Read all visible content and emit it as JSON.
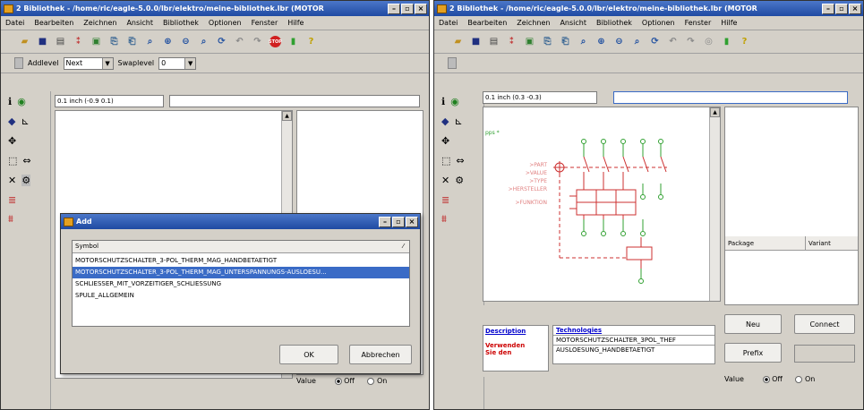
{
  "left_window": {
    "title": "2 Bibliothek - /home/ric/eagle-5.0.0/lbr/elektro/meine-bibliothek.lbr (MOTOR",
    "menu": [
      "Datei",
      "Bearbeiten",
      "Zeichnen",
      "Ansicht",
      "Bibliothek",
      "Optionen",
      "Fenster",
      "Hilfe"
    ],
    "addlevel_label": "Addlevel",
    "addlevel_value": "Next",
    "swaplevel_label": "Swaplevel",
    "swaplevel_value": "0",
    "coords": "0.1 inch (-0.9 0.1)",
    "value_label": "Value",
    "off_label": "Off",
    "on_label": "On"
  },
  "right_window": {
    "title": "2 Bibliothek - /home/ric/eagle-5.0.0/lbr/elektro/meine-bibliothek.lbr (MOTOR",
    "menu": [
      "Datei",
      "Bearbeiten",
      "Zeichnen",
      "Ansicht",
      "Bibliothek",
      "Optionen",
      "Fenster",
      "Hilfe"
    ],
    "coords": "0.1 inch (0.3 -0.3)",
    "schematic_labels": [
      ">PART",
      ">VALUE",
      ">TYPE",
      ">HERSTELLER",
      ">FUNKTION"
    ],
    "package_header": "Package",
    "variant_header": "Variant",
    "description_link": "Description",
    "technologies_link": "Technologies",
    "tech_values": [
      "MOTORSCHUTZSCHALTER_3POL_THEF",
      "AUSLOESUNG_HANDBETAETIGT"
    ],
    "verwenden_text": "Verwenden Sie den",
    "neu_button": "Neu",
    "connect_button": "Connect",
    "prefix_button": "Prefix",
    "value_label": "Value",
    "off_label": "Off",
    "on_label": "On"
  },
  "add_dialog": {
    "title": "Add",
    "column_header": "Symbol",
    "items": [
      "MOTORSCHUTZSCHALTER_3-POL_THERM_MAG_HANDBETAETIGT",
      "MOTORSCHUTZSCHALTER_3-POL_THERM_MAG_UNTERSPANNUNGS-AUSLOESU...",
      "SCHLIESSER_MIT_VORZEITIGER_SCHLIESSUNG",
      "SPULE_ALLGEMEIN"
    ],
    "selected_index": 1,
    "ok_button": "OK",
    "cancel_button": "Abbrechen"
  },
  "colors": {
    "title_bar": "#2a58b0",
    "selection": "#3a6bc6",
    "schematic_red": "#cc3030",
    "schematic_green": "#30a030",
    "link_blue": "#0000cc",
    "warn_red": "#cc0000"
  }
}
